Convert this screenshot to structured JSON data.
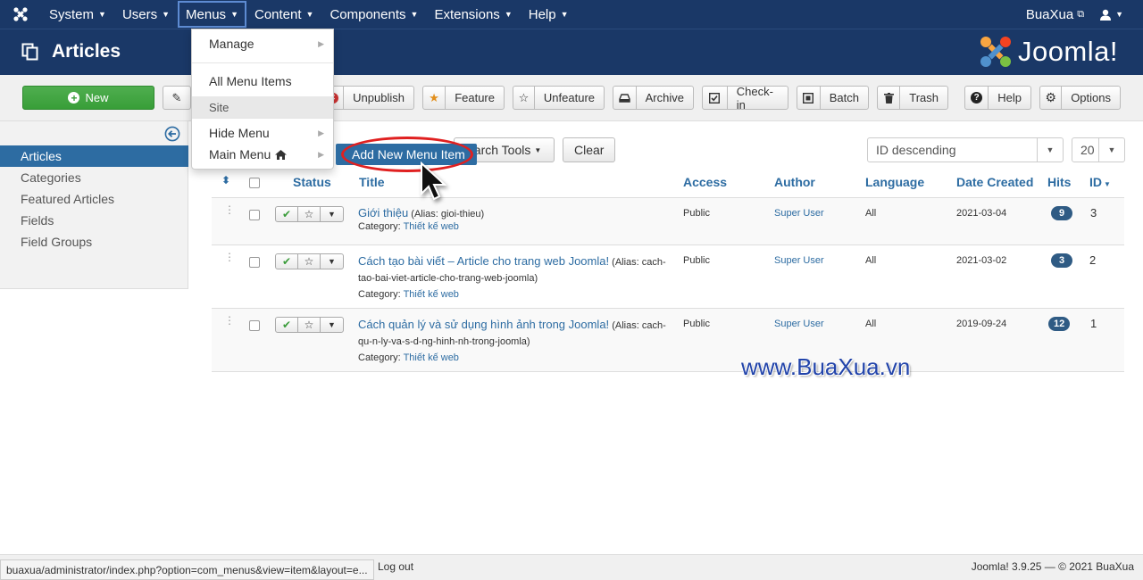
{
  "topnav": {
    "items": [
      {
        "label": "System"
      },
      {
        "label": "Users"
      },
      {
        "label": "Menus"
      },
      {
        "label": "Content"
      },
      {
        "label": "Components"
      },
      {
        "label": "Extensions"
      },
      {
        "label": "Help"
      }
    ],
    "user_site": "BuaXua"
  },
  "header": {
    "page_title": "Articles",
    "brand": "Joomla!"
  },
  "toolbar": {
    "new": "New",
    "unpublish": "Unpublish",
    "feature": "Feature",
    "unfeature": "Unfeature",
    "archive": "Archive",
    "checkin": "Check-in",
    "batch": "Batch",
    "trash": "Trash",
    "help": "Help",
    "options": "Options"
  },
  "sidebar": {
    "items": [
      {
        "label": "Articles"
      },
      {
        "label": "Categories"
      },
      {
        "label": "Featured Articles"
      },
      {
        "label": "Fields"
      },
      {
        "label": "Field Groups"
      }
    ]
  },
  "filters": {
    "search_tools": "earch Tools",
    "clear": "Clear",
    "ordering": "ID descending",
    "limit": "20"
  },
  "menus_dropdown": {
    "items": [
      {
        "label": "Manage"
      },
      {
        "label": "All Menu Items"
      },
      {
        "label": "Site"
      },
      {
        "label": "Hide Menu"
      },
      {
        "label": "Main Menu"
      }
    ],
    "submenu_item": "Add New Menu Item"
  },
  "table": {
    "headers": {
      "status": "Status",
      "title": "Title",
      "access": "Access",
      "author": "Author",
      "language": "Language",
      "date_created": "Date Created",
      "hits": "Hits",
      "id": "ID"
    },
    "rows": [
      {
        "title": "Giới thiệu",
        "alias_line1": "(Alias: gioi-thieu)",
        "alias_line2": "",
        "category_prefix": "Category:",
        "category": "Thiết kế web",
        "access": "Public",
        "author": "Super User",
        "language": "All",
        "date": "2021-03-04",
        "hits": "9",
        "id": "3"
      },
      {
        "title": "Cách tạo bài viết – Article cho trang web Joomla!",
        "alias_line1": "(Alias: cach-",
        "alias_line2": "tao-bai-viet-article-cho-trang-web-joomla)",
        "category_prefix": "Category:",
        "category": "Thiết kế web",
        "access": "Public",
        "author": "Super User",
        "language": "All",
        "date": "2021-03-02",
        "hits": "3",
        "id": "2"
      },
      {
        "title": "Cách quản lý và sử dụng hình ảnh trong Joomla!",
        "alias_line1": "(Alias: cach-",
        "alias_line2": "qu-n-ly-va-s-d-ng-hinh-nh-trong-joomla)",
        "category_prefix": "Category:",
        "category": "Thiết kế web",
        "access": "Public",
        "author": "Super User",
        "language": "All",
        "date": "2019-09-24",
        "hits": "12",
        "id": "1"
      }
    ]
  },
  "watermark": "www.BuaXua.vn",
  "footer": {
    "status_url": "buaxua/administrator/index.php?option=com_menus&view=item&layout=e...",
    "logout": "Log out",
    "version": "Joomla! 3.9.25  —  © 2021 BuaXua"
  },
  "colors": {
    "nav_bg": "#1a3867",
    "accent": "#2d6ca2",
    "new_button": "#3a9c3a",
    "highlight_oval": "#e02020"
  }
}
